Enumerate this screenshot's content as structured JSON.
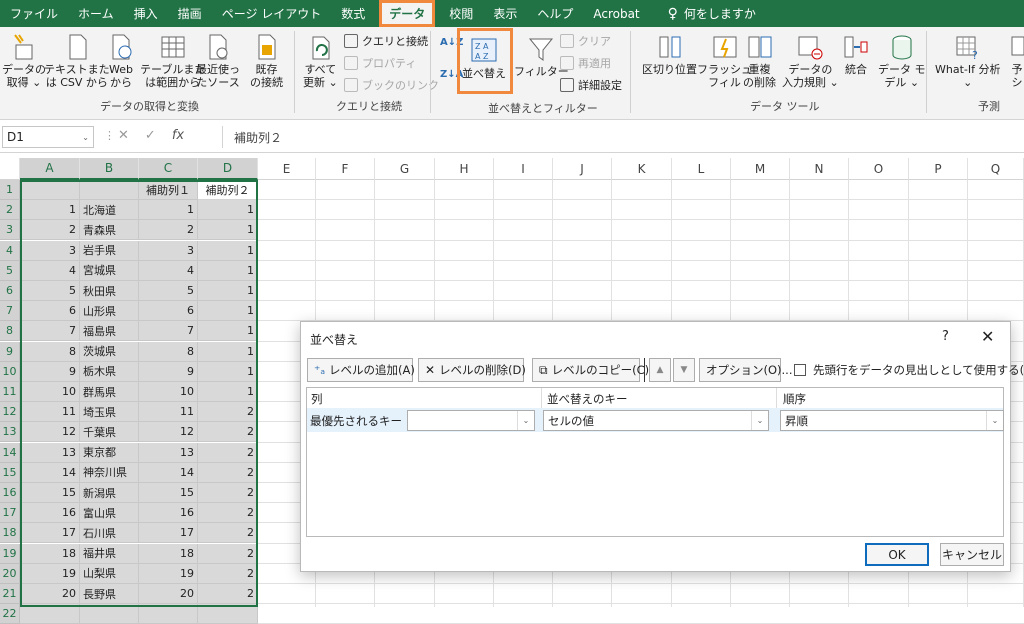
{
  "tabs": [
    "ファイル",
    "ホーム",
    "挿入",
    "描画",
    "ページ レイアウト",
    "数式",
    "データ",
    "校閲",
    "表示",
    "ヘルプ",
    "Acrobat",
    "何をしますか"
  ],
  "ribbon": {
    "get_data": [
      "データの",
      "取得 ⌄"
    ],
    "text_csv": [
      "テキストまた",
      "は CSV から"
    ],
    "web": [
      "Web",
      "から"
    ],
    "table_range": [
      "テーブルまた",
      "は範囲から"
    ],
    "recent": [
      "最近使っ",
      "たソース"
    ],
    "existing": [
      "既存",
      "の接続"
    ],
    "group_get": "データの取得と変換",
    "refresh_all": [
      "すべて",
      "更新 ⌄"
    ],
    "queries": "クエリと接続",
    "properties": "プロパティ",
    "book_links": "ブックのリンク",
    "group_queries": "クエリと接続",
    "sort": "並べ替え",
    "filter": "フィルター",
    "clear": "クリア",
    "reapply": "再適用",
    "advanced": "詳細設定",
    "group_sort": "並べ替えとフィルター",
    "text_to_col": "区切り位置",
    "flash": [
      "フラッシュ",
      "フィル"
    ],
    "remove_dup": [
      "重複",
      "の削除"
    ],
    "validation": [
      "データの",
      "入力規則 ⌄"
    ],
    "consolidate": "統合",
    "model": [
      "データ モ",
      "デル ⌄"
    ],
    "group_tools": "データ ツール",
    "whatif": [
      "What-If 分析",
      "⌄"
    ],
    "forecast": [
      "予",
      "シ"
    ],
    "group_forecast": "予測"
  },
  "formula_bar": {
    "name_box": "D1",
    "fx": "fx",
    "value": "補助列２"
  },
  "columns": [
    "A",
    "B",
    "C",
    "D",
    "E",
    "F",
    "G",
    "H",
    "I",
    "J",
    "K",
    "L",
    "M",
    "N",
    "O",
    "P",
    "Q"
  ],
  "header_row": {
    "c": "補助列１",
    "d": "補助列２"
  },
  "rows": [
    {
      "a": "1",
      "b": "北海道",
      "c": "1",
      "d": "1"
    },
    {
      "a": "2",
      "b": "青森県",
      "c": "2",
      "d": "1"
    },
    {
      "a": "3",
      "b": "岩手県",
      "c": "3",
      "d": "1"
    },
    {
      "a": "4",
      "b": "宮城県",
      "c": "4",
      "d": "1"
    },
    {
      "a": "5",
      "b": "秋田県",
      "c": "5",
      "d": "1"
    },
    {
      "a": "6",
      "b": "山形県",
      "c": "6",
      "d": "1"
    },
    {
      "a": "7",
      "b": "福島県",
      "c": "7",
      "d": "1"
    },
    {
      "a": "8",
      "b": "茨城県",
      "c": "8",
      "d": "1"
    },
    {
      "a": "9",
      "b": "栃木県",
      "c": "9",
      "d": "1"
    },
    {
      "a": "10",
      "b": "群馬県",
      "c": "10",
      "d": "1"
    },
    {
      "a": "11",
      "b": "埼玉県",
      "c": "11",
      "d": "2"
    },
    {
      "a": "12",
      "b": "千葉県",
      "c": "12",
      "d": "2"
    },
    {
      "a": "13",
      "b": "東京都",
      "c": "13",
      "d": "2"
    },
    {
      "a": "14",
      "b": "神奈川県",
      "c": "14",
      "d": "2"
    },
    {
      "a": "15",
      "b": "新潟県",
      "c": "15",
      "d": "2"
    },
    {
      "a": "16",
      "b": "富山県",
      "c": "16",
      "d": "2"
    },
    {
      "a": "17",
      "b": "石川県",
      "c": "17",
      "d": "2"
    },
    {
      "a": "18",
      "b": "福井県",
      "c": "18",
      "d": "2"
    },
    {
      "a": "19",
      "b": "山梨県",
      "c": "19",
      "d": "2"
    },
    {
      "a": "20",
      "b": "長野県",
      "c": "20",
      "d": "2"
    }
  ],
  "dialog": {
    "title": "並べ替え",
    "help": "?",
    "close": "✕",
    "add_level": "レベルの追加(A)",
    "delete_level": "レベルの削除(D)",
    "copy_level": "レベルのコピー(C)",
    "options": "オプション(O)...",
    "header_checkbox": "先頭行をデータの見出しとして使用する(H)",
    "col_header": "列",
    "key_header": "並べ替えのキー",
    "order_header": "順序",
    "row_label": "最優先されるキー",
    "column_value": "",
    "key_value": "セルの値",
    "order_value": "昇順",
    "ok": "OK",
    "cancel": "キャンセル"
  },
  "colors": {
    "excel_green": "#217346",
    "highlight": "#f0883e"
  }
}
